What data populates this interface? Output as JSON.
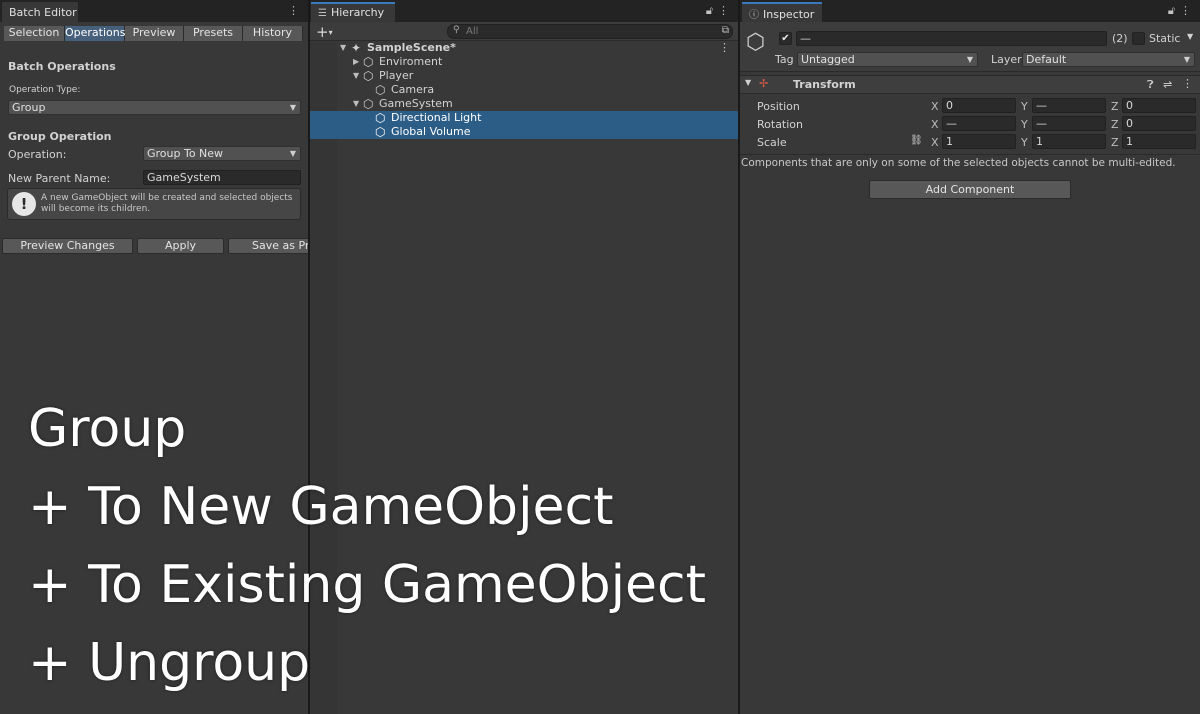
{
  "batch_editor": {
    "tab_title": "Batch Editor",
    "subtabs": [
      "Selection",
      "Operations",
      "Preview",
      "Presets",
      "History"
    ],
    "active_subtab": "Operations",
    "section_title": "Batch Operations",
    "operation_type_label": "Operation Type:",
    "operation_type_value": "Group",
    "group_section_title": "Group Operation",
    "operation_label": "Operation:",
    "operation_value": "Group To New",
    "new_parent_label": "New Parent Name:",
    "new_parent_value": "GameSystem",
    "help_text": "A new GameObject will be created and selected objects will become its children.",
    "buttons": {
      "preview": "Preview Changes",
      "apply": "Apply",
      "save_preset": "Save as Preset"
    }
  },
  "hierarchy": {
    "tab_title": "Hierarchy",
    "search_placeholder": "All",
    "scene_name": "SampleScene*",
    "items": [
      {
        "name": "Enviroment",
        "depth": 1,
        "expanded": false,
        "selected": false
      },
      {
        "name": "Player",
        "depth": 1,
        "expanded": true,
        "selected": false
      },
      {
        "name": "Camera",
        "depth": 2,
        "expanded": null,
        "selected": false
      },
      {
        "name": "GameSystem",
        "depth": 1,
        "expanded": true,
        "selected": false
      },
      {
        "name": "Directional Light",
        "depth": 2,
        "expanded": null,
        "selected": true
      },
      {
        "name": "Global Volume",
        "depth": 2,
        "expanded": null,
        "selected": true
      }
    ]
  },
  "inspector": {
    "tab_title": "Inspector",
    "object_name": "—",
    "selection_count": "(2)",
    "static_label": "Static",
    "tag_label": "Tag",
    "tag_value": "Untagged",
    "layer_label": "Layer",
    "layer_value": "Default",
    "component_title": "Transform",
    "position_label": "Position",
    "rotation_label": "Rotation",
    "scale_label": "Scale",
    "axes": {
      "x": "X",
      "y": "Y",
      "z": "Z"
    },
    "position": {
      "x": "0",
      "y": "—",
      "z": "0"
    },
    "rotation": {
      "x": "—",
      "y": "—",
      "z": "0"
    },
    "scale": {
      "x": "1",
      "y": "1",
      "z": "1"
    },
    "notice": "Components that are only on some of the selected objects cannot be multi-edited.",
    "add_component": "Add Component"
  },
  "caption": {
    "line1": "Group",
    "line2": "+ To New GameObject",
    "line3": "+ To Existing GameObject",
    "line4": "+ Ungroup"
  },
  "colors": {
    "panel_bg": "#383838",
    "tab_accent": "#3a79bb",
    "selection": "#2c5d87",
    "active_subtab": "#46607c"
  },
  "icons": [
    "kebab-menu-icon",
    "lock-icon",
    "plus-icon",
    "search-icon",
    "unity-scene-icon",
    "gameobject-cube-icon",
    "info-icon",
    "transform-icon",
    "help-icon",
    "preset-icon",
    "link-scale-icon",
    "warning-icon"
  ]
}
